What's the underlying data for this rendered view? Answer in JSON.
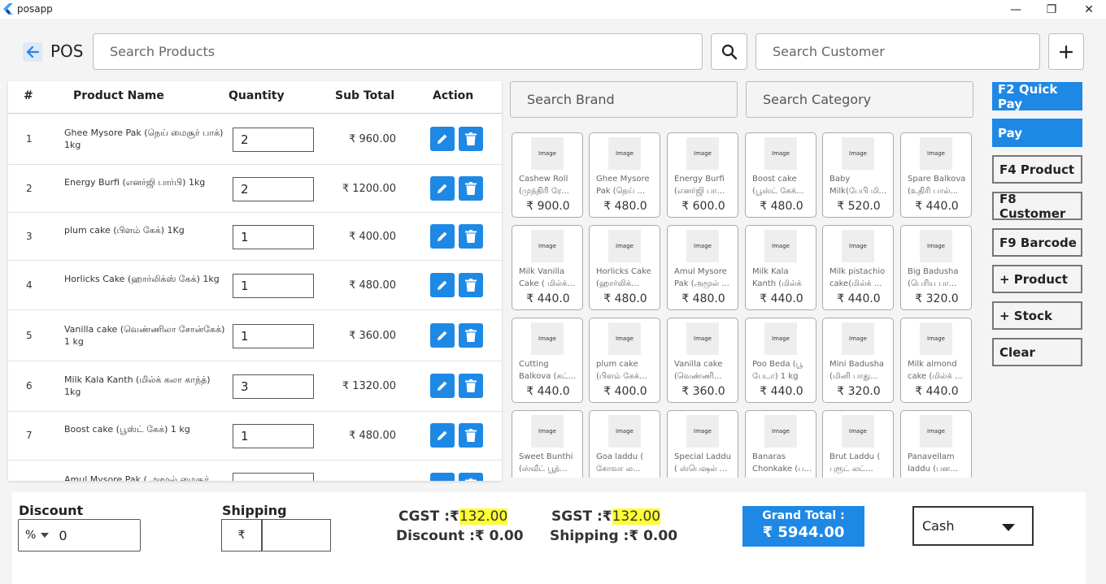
{
  "window": {
    "title": "posapp",
    "controls": {
      "minimize": "—",
      "restore": "❐",
      "close": "✕"
    }
  },
  "header": {
    "title": "POS",
    "product_search_placeholder": "Search Products",
    "customer_search_placeholder": "Search Customer"
  },
  "cart": {
    "columns": [
      "#",
      "Product Name",
      "Quantity",
      "Sub Total",
      "Action"
    ],
    "rows": [
      {
        "num": "1",
        "name": "Ghee Mysore Pak (நெய் மைசூர் பாக்) 1kg",
        "qty": "2",
        "subtotal": "₹ 960.00"
      },
      {
        "num": "2",
        "name": "Energy Burfi (எனர்ஜி பார்பி) 1kg",
        "qty": "2",
        "subtotal": "₹ 1200.00"
      },
      {
        "num": "3",
        "name": "plum cake (பிளம் கேக்) 1Kg",
        "qty": "1",
        "subtotal": "₹ 400.00"
      },
      {
        "num": "4",
        "name": "Horlicks Cake  (ஹார்லிக்ஸ் கேக்) 1kg",
        "qty": "1",
        "subtotal": "₹ 480.00"
      },
      {
        "num": "5",
        "name": "Vanilla cake (வெண்ணிலா சோன்கேக்) 1 kg",
        "qty": "1",
        "subtotal": "₹ 360.00"
      },
      {
        "num": "6",
        "name": "Milk Kala Kanth (மில்க் கலா காந்த்) 1kg",
        "qty": "3",
        "subtotal": "₹ 1320.00"
      },
      {
        "num": "7",
        "name": "Boost cake (பூஸ்ட் கேக்) 1 kg",
        "qty": "1",
        "subtotal": "₹ 480.00"
      },
      {
        "num": "",
        "name": "Amul Mysore Pak ( அமூல் மைசூர்",
        "qty": "",
        "subtotal": ""
      }
    ]
  },
  "filters": {
    "brand_placeholder": "Search Brand",
    "category_placeholder": "Search Category"
  },
  "products": {
    "image_placeholder": "Image",
    "items": [
      {
        "name": "Cashew Roll (முந்திரி ரே...",
        "price": "₹ 900.0"
      },
      {
        "name": "Ghee Mysore Pak (நெய் ...",
        "price": "₹ 480.0"
      },
      {
        "name": "Energy Burfi (எனர்ஜி பா...",
        "price": "₹ 600.0"
      },
      {
        "name": "Boost cake (பூஸ்ட் கேக்...",
        "price": "₹ 480.0"
      },
      {
        "name": "Baby Milk(பேபி மி...",
        "price": "₹ 520.0"
      },
      {
        "name": "Spare Balkova (உதிரி பால்...",
        "price": "₹ 440.0"
      },
      {
        "name": "Milk Vanilla Cake ( மில்க்...",
        "price": "₹ 440.0"
      },
      {
        "name": "Horlicks Cake (ஹார்லிக்...",
        "price": "₹ 480.0"
      },
      {
        "name": "Amul Mysore Pak (அமூல் ...",
        "price": "₹ 480.0"
      },
      {
        "name": "Milk Kala Kanth (மில்க் கலா...",
        "price": "₹ 440.0"
      },
      {
        "name": "Milk pistachio cake(மில்க் ...",
        "price": "₹ 440.0"
      },
      {
        "name": "Big Badusha (பெரிய பா...",
        "price": "₹ 320.0"
      },
      {
        "name": "Cutting Balkova (கட்...",
        "price": "₹ 440.0"
      },
      {
        "name": "plum cake (பிளம் கேக்...",
        "price": "₹ 400.0"
      },
      {
        "name": "Vanilla cake (வெண்ணி...",
        "price": "₹ 360.0"
      },
      {
        "name": "Poo Beda (பூ பேடா) 1 kg",
        "price": "₹ 440.0"
      },
      {
        "name": "Mini Badusha (மினி பாது...",
        "price": "₹ 320.0"
      },
      {
        "name": "Milk almond cake (மில்க் ...",
        "price": "₹ 440.0"
      },
      {
        "name": "Sweet Bunthi (ஸ்வீட் பூந்...",
        "price": ""
      },
      {
        "name": "Goa laddu ( கோவா ல...",
        "price": ""
      },
      {
        "name": "Special Laddu ( ஸ்பெஷல் ...",
        "price": ""
      },
      {
        "name": "Banaras Chonkake (ப...",
        "price": ""
      },
      {
        "name": "Brut Laddu ( புரூட் லட்...",
        "price": ""
      },
      {
        "name": "Panavellam laddu  (பன...",
        "price": ""
      }
    ]
  },
  "side_buttons": {
    "quick_pay": "F2 Quick Pay",
    "pay": "Pay",
    "product": "F4 Product",
    "customer": "F8 Customer",
    "barcode": "F9 Barcode",
    "add_product": "+  Product",
    "add_stock": "+  Stock",
    "clear": "Clear"
  },
  "footer": {
    "discount_label": "Discount",
    "discount_type": "%",
    "discount_value": "0",
    "shipping_label": "Shipping",
    "shipping_currency": "₹",
    "shipping_value": "",
    "cgst_label": "CGST :₹",
    "cgst_value": "132.00",
    "discount_total": "Discount :₹ 0.00",
    "sgst_label": "SGST :₹",
    "sgst_value": "132.00",
    "shipping_total": "Shipping :₹ 0.00",
    "grand_total_label": "Grand Total :",
    "grand_total_value": "₹ 5944.00",
    "payment_method": "Cash"
  },
  "colors": {
    "accent": "#1e88e5",
    "highlight": "#ffff33"
  }
}
